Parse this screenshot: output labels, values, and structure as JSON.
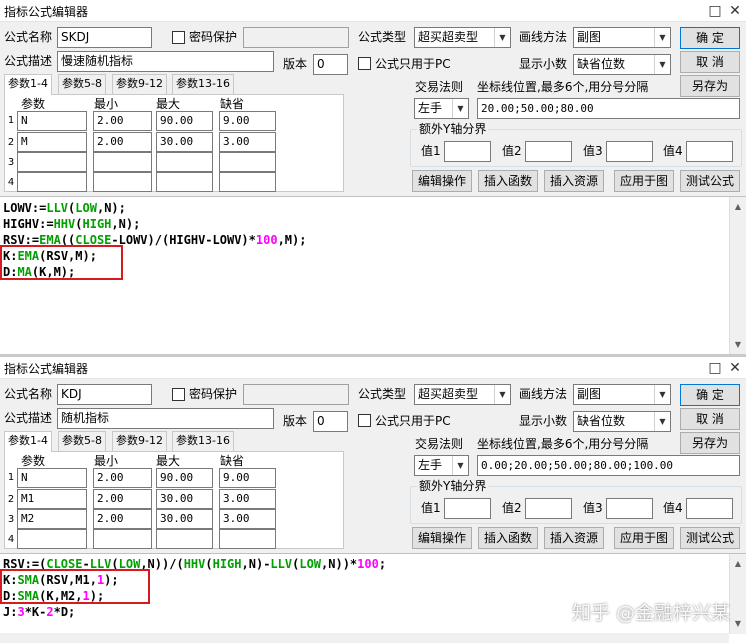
{
  "window_title": "指标公式编辑器",
  "window_controls": {
    "minimize": "□",
    "close": "✕"
  },
  "labels": {
    "name": "公式名称",
    "desc": "公式描述",
    "password": "密码保护",
    "version": "版本",
    "type": "公式类型",
    "draw_method": "画线方法",
    "pc_only": "公式只用于PC",
    "decimal": "显示小数",
    "trade_rule": "交易法则",
    "axis_pos": "坐标线位置,最多6个,用分号分隔",
    "extra_y": "额外Y轴分界",
    "val1": "值1",
    "val2": "值2",
    "val3": "值3",
    "val4": "值4"
  },
  "tabs": [
    "参数1-4",
    "参数5-8",
    "参数9-12",
    "参数13-16"
  ],
  "grid_headers": [
    "参数",
    "最小",
    "最大",
    "缺省"
  ],
  "row_numbers": [
    "1",
    "2",
    "3",
    "4"
  ],
  "buttons": {
    "ok": "确 定",
    "cancel": "取 消",
    "save_as": "另存为",
    "edit_op": "编辑操作",
    "insert_func": "插入函数",
    "insert_res": "插入资源",
    "apply_chart": "应用于图",
    "test": "测试公式"
  },
  "windows": [
    {
      "formula_name": "SKDJ",
      "description": "慢速随机指标",
      "version": "0",
      "formula_type": "超买超卖型",
      "draw_method": "副图",
      "decimal": "缺省位数",
      "trade_rule": "左手",
      "axis_positions": "20.00;50.00;80.00",
      "params": [
        [
          "N",
          "2.00",
          "90.00",
          "9.00"
        ],
        [
          "M",
          "2.00",
          "30.00",
          "3.00"
        ],
        [
          "",
          "",
          "",
          ""
        ],
        [
          "",
          "",
          "",
          ""
        ]
      ],
      "code": [
        [
          [
            "LOWV:=",
            "op"
          ],
          [
            "LLV",
            "fn"
          ],
          [
            "(",
            "op"
          ],
          [
            "LOW",
            "fn"
          ],
          [
            ",N);",
            "op"
          ]
        ],
        [
          [
            "HIGHV:=",
            "op"
          ],
          [
            "HHV",
            "fn"
          ],
          [
            "(",
            "op"
          ],
          [
            "HIGH",
            "fn"
          ],
          [
            ",N);",
            "op"
          ]
        ],
        [
          [
            "RSV:=",
            "op"
          ],
          [
            "EMA",
            "fn"
          ],
          [
            "((",
            "op"
          ],
          [
            "CLOSE",
            "fn"
          ],
          [
            "-LOWV)/(HIGHV-LOWV)*",
            "op"
          ],
          [
            "100",
            "num"
          ],
          [
            ",M);",
            "op"
          ]
        ],
        [
          [
            "K:",
            "op"
          ],
          [
            "EMA",
            "fn"
          ],
          [
            "(RSV,M);",
            "op"
          ]
        ],
        [
          [
            "D:",
            "op"
          ],
          [
            "MA",
            "fn"
          ],
          [
            "(K,M);",
            "op"
          ]
        ]
      ]
    },
    {
      "formula_name": "KDJ",
      "description": "随机指标",
      "version": "0",
      "formula_type": "超买超卖型",
      "draw_method": "副图",
      "decimal": "缺省位数",
      "trade_rule": "左手",
      "axis_positions": "0.00;20.00;50.00;80.00;100.00",
      "params": [
        [
          "N",
          "2.00",
          "90.00",
          "9.00"
        ],
        [
          "M1",
          "2.00",
          "30.00",
          "3.00"
        ],
        [
          "M2",
          "2.00",
          "30.00",
          "3.00"
        ],
        [
          "",
          "",
          "",
          ""
        ]
      ],
      "code": [
        [
          [
            "RSV:=(",
            "op"
          ],
          [
            "CLOSE",
            "fn"
          ],
          [
            "-",
            "op"
          ],
          [
            "LLV",
            "fn"
          ],
          [
            "(",
            "op"
          ],
          [
            "LOW",
            "fn"
          ],
          [
            ",N))/(",
            "op"
          ],
          [
            "HHV",
            "fn"
          ],
          [
            "(",
            "op"
          ],
          [
            "HIGH",
            "fn"
          ],
          [
            ",N)-",
            "op"
          ],
          [
            "LLV",
            "fn"
          ],
          [
            "(",
            "op"
          ],
          [
            "LOW",
            "fn"
          ],
          [
            ",N))*",
            "op"
          ],
          [
            "100",
            "num"
          ],
          [
            ";",
            "op"
          ]
        ],
        [
          [
            "K:",
            "op"
          ],
          [
            "SMA",
            "fn"
          ],
          [
            "(RSV,M1,",
            "op"
          ],
          [
            "1",
            "num"
          ],
          [
            ");",
            "op"
          ]
        ],
        [
          [
            "D:",
            "op"
          ],
          [
            "SMA",
            "fn"
          ],
          [
            "(K,M2,",
            "op"
          ],
          [
            "1",
            "num"
          ],
          [
            ");",
            "op"
          ]
        ],
        [
          [
            "J:",
            "op"
          ],
          [
            "3",
            "num"
          ],
          [
            "*K-",
            "op"
          ],
          [
            "2",
            "num"
          ],
          [
            "*D;",
            "op"
          ]
        ]
      ]
    }
  ],
  "watermark": "知乎 @金融梓兴某"
}
